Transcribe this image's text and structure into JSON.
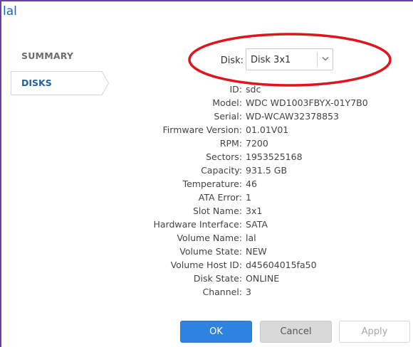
{
  "window": {
    "title": "lal"
  },
  "sidebar": {
    "items": [
      {
        "label": "SUMMARY",
        "selected": false
      },
      {
        "label": "DISKS",
        "selected": true
      }
    ]
  },
  "disk_selector": {
    "label": "Disk:",
    "value": "Disk 3x1"
  },
  "details": [
    {
      "key": "ID:",
      "value": "sdc"
    },
    {
      "key": "Model:",
      "value": "WDC WD1003FBYX-01Y7B0"
    },
    {
      "key": "Serial:",
      "value": "WD-WCAW32378853"
    },
    {
      "key": "Firmware Version:",
      "value": "01.01V01"
    },
    {
      "key": "RPM:",
      "value": "7200"
    },
    {
      "key": "Sectors:",
      "value": "1953525168"
    },
    {
      "key": "Capacity:",
      "value": "931.5 GB"
    },
    {
      "key": "Temperature:",
      "value": "46"
    },
    {
      "key": "ATA Error:",
      "value": "1"
    },
    {
      "key": "Slot Name:",
      "value": "3x1"
    },
    {
      "key": "Hardware Interface:",
      "value": "SATA"
    },
    {
      "key": "Volume Name:",
      "value": "lal"
    },
    {
      "key": "Volume State:",
      "value": "NEW"
    },
    {
      "key": "Volume Host ID:",
      "value": "d45604015fa50"
    },
    {
      "key": "Disk State:",
      "value": "ONLINE"
    },
    {
      "key": "Channel:",
      "value": "3"
    }
  ],
  "buttons": {
    "ok": "OK",
    "cancel": "Cancel",
    "apply": "Apply"
  },
  "colors": {
    "accent": "#2f83e0",
    "title": "#1a63c7",
    "annotation": "#e0141b",
    "frame": "#6a3fa0"
  }
}
